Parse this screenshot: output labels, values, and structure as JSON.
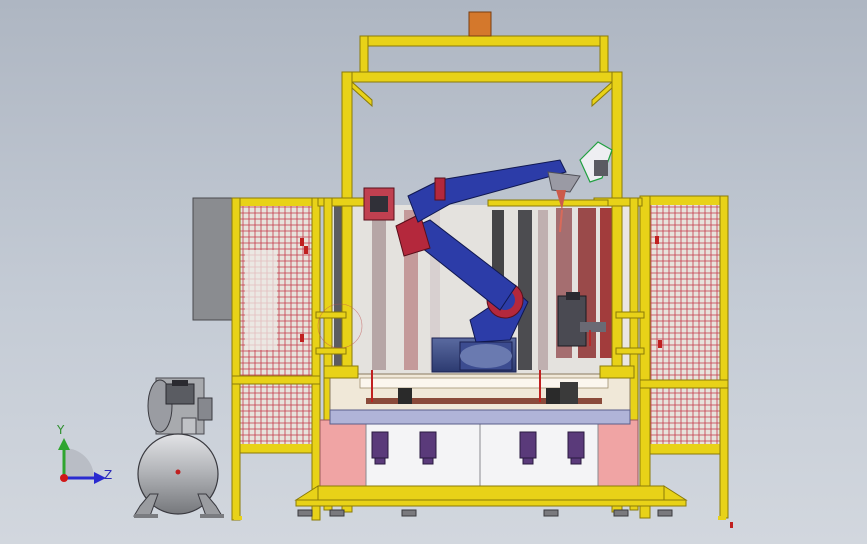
{
  "view_triad": {
    "y_label": "Y",
    "z_label": "Z",
    "y_color": "#2fa52f",
    "z_color": "#2a2ad0",
    "origin_color": "#d01818"
  },
  "colors": {
    "background": "#bcc4d0",
    "frame_yellow": "#e8d218",
    "robot_blue": "#2c3ca8",
    "robot_red": "#b4283c",
    "mesh_red": "#c8303c",
    "compressor_gray": "#a8aaae",
    "motor_orange": "#d4782c"
  },
  "icons": [
    "robot-arm-icon",
    "air-compressor-icon",
    "coordinate-triad-icon"
  ]
}
